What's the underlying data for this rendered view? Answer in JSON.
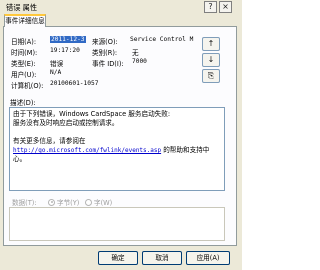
{
  "window": {
    "title": "错误 属性",
    "help_glyph": "?",
    "close_glyph": "×"
  },
  "tabs": [
    {
      "label": "事件详细信息",
      "selected": true
    }
  ],
  "fields": {
    "date": {
      "label": "日期(A):",
      "value": "2011-12-3"
    },
    "source": {
      "label": "来源(O):",
      "value": "Service Control M"
    },
    "time": {
      "label": "时间(M):",
      "value": "19:17:20"
    },
    "category": {
      "label": "类别(R):",
      "value": "无"
    },
    "type": {
      "label": "类型(E):",
      "value": "错误"
    },
    "event_id": {
      "label": "事件 ID(I):",
      "value": "7000"
    },
    "user": {
      "label": "用户(U):",
      "value": "N/A"
    },
    "computer": {
      "label": "计算机(O):",
      "value": "20100601-1057"
    }
  },
  "side_buttons": {
    "up": "↑",
    "down": "↓",
    "copy": "⎘"
  },
  "description": {
    "label": "描述(D):",
    "line1": "由于下列错误，Windows CardSpace 服务启动失败:",
    "line2": "服务没有及时响应启动或控制请求。",
    "line3": "有关更多信息，请参阅在",
    "link": "http://go.microsoft.com/fwlink/events.asp",
    "line4_suffix": " 的帮助和支持中",
    "line5": "心。"
  },
  "data_section": {
    "label": "数据(T):",
    "bytes_label": "字节(Y)",
    "words_label": "字(W)",
    "selected": "bytes"
  },
  "buttons": {
    "ok": "确定",
    "cancel": "取消",
    "apply": "应用(A)"
  }
}
